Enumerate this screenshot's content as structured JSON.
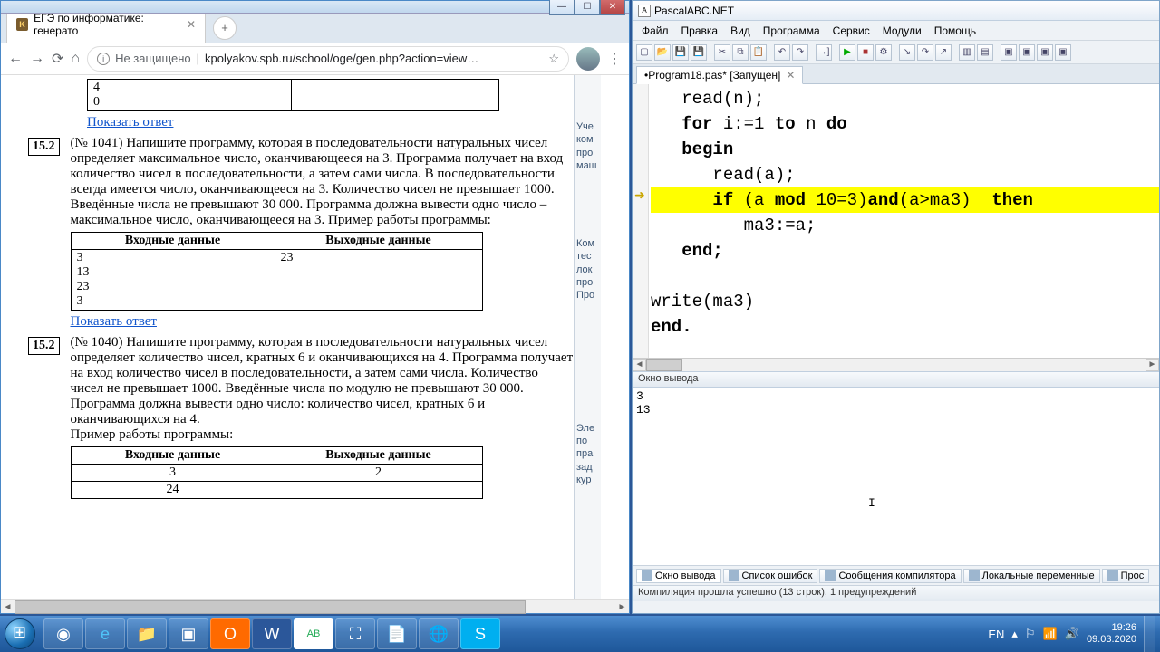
{
  "browser": {
    "tab_title": "ЕГЭ по информатике: генерато",
    "win_buttons": {
      "min": "—",
      "max": "☐",
      "close": "✕"
    },
    "toolbar": {
      "back": "←",
      "forward": "→",
      "reload": "⟳",
      "home": "⌂",
      "security": "Не защищено",
      "url": "kpolyakov.spb.ru/school/oge/gen.php?action=view…",
      "star": "☆"
    },
    "page": {
      "top_table_row": [
        "4",
        "0"
      ],
      "show_answer": "Показать ответ",
      "tasks": [
        {
          "num": "15.2",
          "ref": "(№ 1041)",
          "text": "Напишите программу, которая в последовательности натуральных чисел определяет максимальное число, оканчивающееся на 3. Программа получает на вход количество чисел в последовательности, а затем сами числа. В последовательности всегда имеется число, оканчивающееся на 3. Количество чисел не превышает 1000. Введённые числа не превышают 30 000. Программа должна вывести одно число – максимальное число, оканчивающееся на 3. Пример работы программы:",
          "table_head": [
            "Входные данные",
            "Выходные данные"
          ],
          "in": "3\n13\n23\n3",
          "out": "23"
        },
        {
          "num": "15.2",
          "ref": "(№ 1040)",
          "text": "Напишите программу, которая в последовательности натуральных чисел определяет количество чисел, кратных 6 и оканчивающихся на 4. Программа получает на вход количество чисел в последовательности, а затем сами числа. Количество чисел не превышает 1000. Введённые числа по модулю не превышают 30 000. Программа должна вывести одно число: количество чисел, кратных 6 и оканчивающихся на 4.",
          "example_label": "Пример работы программы:",
          "table_head": [
            "Входные данные",
            "Выходные данные"
          ],
          "in_rows": [
            "3",
            "24"
          ],
          "out_rows": [
            "2",
            ""
          ]
        }
      ],
      "side_snippets": [
        "Уче\nком\nпро\nмаш",
        "Ком\nтес\nлок\nпро\nПро",
        "Эле\nпо\nпра\nзад\nкур"
      ]
    }
  },
  "ide": {
    "title": "PascalABC.NET",
    "menu": [
      "Файл",
      "Правка",
      "Вид",
      "Программа",
      "Сервис",
      "Модули",
      "Помощь"
    ],
    "tab": "•Program18.pas* [Запущен]",
    "code_lines": [
      {
        "t": "read(n);",
        "indent": 1
      },
      {
        "kw": true,
        "parts": [
          "for",
          " i:=1 ",
          "to",
          " n ",
          "do"
        ],
        "indent": 1
      },
      {
        "kw": true,
        "t": "begin",
        "indent": 1
      },
      {
        "t": "read(a);",
        "indent": 2
      },
      {
        "hl": true,
        "indent": 2,
        "parts_kw": [
          "if",
          " (a ",
          "mod",
          " 10=3)",
          "and",
          "(a>ma3)  ",
          "then"
        ]
      },
      {
        "t": "ma3:=a;",
        "indent": 3
      },
      {
        "kw": true,
        "t": "end;",
        "indent": 1
      },
      {
        "t": "",
        "indent": 0
      },
      {
        "t": "write(ma3)",
        "indent": 0
      },
      {
        "kw": true,
        "t": "end.",
        "indent": 0
      }
    ],
    "marker_at_line": 4,
    "output_header": "Окно вывода",
    "output_body": "3\n13",
    "bottom_tabs": [
      "Окно вывода",
      "Список ошибок",
      "Сообщения компилятора",
      "Локальные переменные",
      "Прос"
    ],
    "status": "Компиляция прошла успешно (13 строк), 1 предупреждений"
  },
  "taskbar": {
    "items": [
      "◉",
      "e",
      "📁",
      "▣",
      "O",
      "W",
      "AB",
      "⛶",
      "📄",
      "🌐",
      "S"
    ],
    "tray": {
      "lang": "EN",
      "clock_time": "19:26",
      "clock_date": "09.03.2020"
    }
  }
}
